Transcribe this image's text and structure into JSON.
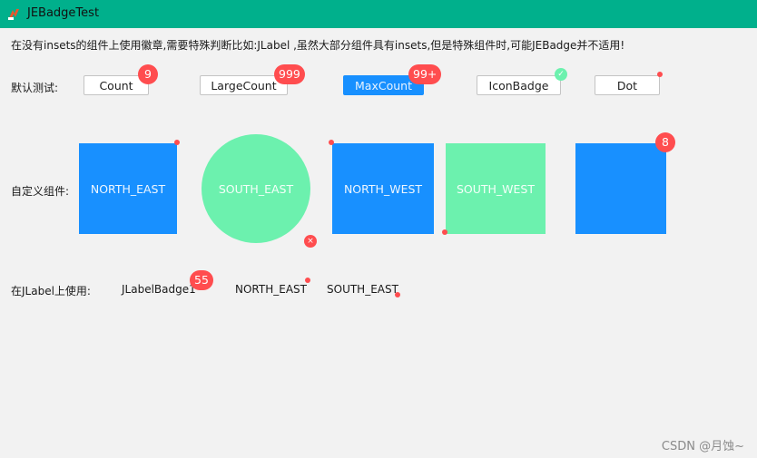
{
  "window": {
    "title": "JEBadgeTest",
    "app_icon": "java-app-icon"
  },
  "description": "在没有insets的组件上使用徽章,需要特殊判断比如:JLabel ,虽然大部分组件具有insets,但是特殊组件时,可能JEBadge并不适用!",
  "colors": {
    "titlebar": "#00b08c",
    "badge": "#ff4d4f",
    "primary": "#1890ff",
    "green": "#6cf1ae",
    "background": "#f2f2f2"
  },
  "default_test": {
    "label": "默认测试:",
    "buttons": [
      {
        "label": "Count",
        "badge_type": "count",
        "badge": "9"
      },
      {
        "label": "LargeCount",
        "badge_type": "count",
        "badge": "999"
      },
      {
        "label": "MaxCount",
        "badge_type": "count",
        "badge": "99+",
        "style": "primary"
      },
      {
        "label": "IconBadge",
        "badge_type": "icon",
        "badge_icon": "check-icon",
        "badge": "✓"
      },
      {
        "label": "Dot",
        "badge_type": "dot"
      }
    ]
  },
  "custom_components": {
    "label": "自定义组件:",
    "panels": [
      {
        "text": "NORTH_EAST",
        "shape": "square",
        "color": "blue",
        "badge_type": "dot",
        "position": "north-east"
      },
      {
        "text": "SOUTH_EAST",
        "shape": "circle",
        "color": "green",
        "badge_type": "icon",
        "badge": "×",
        "position": "south-east"
      },
      {
        "text": "NORTH_WEST",
        "shape": "square",
        "color": "blue",
        "badge_type": "dot",
        "position": "north-west"
      },
      {
        "text": "SOUTH_WEST",
        "shape": "square",
        "color": "green",
        "badge_type": "dot",
        "position": "south-west"
      },
      {
        "text": "",
        "shape": "square",
        "color": "blue",
        "badge_type": "count",
        "badge": "8",
        "position": "north-east"
      }
    ]
  },
  "jlabel_usage": {
    "label": "在JLabel上使用:",
    "labels": [
      {
        "text": "JLabelBadge1",
        "badge_type": "count",
        "badge": "55"
      },
      {
        "text": "NORTH_EAST",
        "badge_type": "dot"
      },
      {
        "text": "SOUTH_EAST",
        "badge_type": "dot"
      }
    ]
  },
  "watermark": "CSDN @月蚀~"
}
